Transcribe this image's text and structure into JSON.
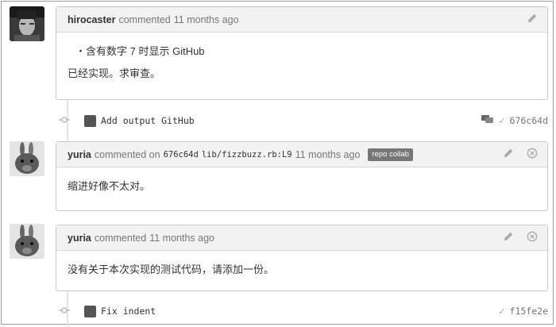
{
  "comments": [
    {
      "author": "hirocaster",
      "action": "commented",
      "time": "11 months ago",
      "bullet": "含有数字 7 时显示 GitHub",
      "text": "已经实现。求审查。"
    },
    {
      "author": "yuria",
      "action": "commented on",
      "commit_ref": "676c64d",
      "file_ref": "lib/fizzbuzz.rb:L9",
      "time": "11 months ago",
      "badge": "repo collab",
      "text": "缩进好像不太对。"
    },
    {
      "author": "yuria",
      "action": "commented",
      "time": "11 months ago",
      "text": "没有关于本次实现的测试代码，请添加一份。"
    }
  ],
  "commits": [
    {
      "message": "Add output GitHub",
      "sha": "676c64d"
    },
    {
      "message": "Fix indent",
      "sha": "f15fe2e"
    }
  ],
  "icons": {
    "edit": "pencil-icon",
    "delete": "close-circle-icon",
    "comment": "comment-icon",
    "check": "checkmark-icon",
    "commit": "commit-node-icon"
  },
  "colors": {
    "header_bg": "#f2f2f2",
    "border": "#c9c9c9",
    "badge_bg": "#777777"
  }
}
